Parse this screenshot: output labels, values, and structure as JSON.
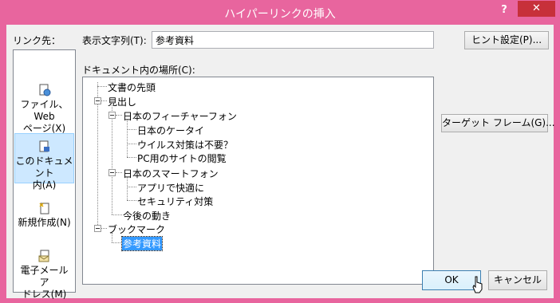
{
  "window": {
    "title": "ハイパーリンクの挿入",
    "help": "?",
    "close": "✕"
  },
  "linkto_label": "リンク先：",
  "sidebar": {
    "items": [
      {
        "label_l1": "ファイル、Web",
        "label_l2": "ページ(X)",
        "icon": "web-page-icon"
      },
      {
        "label_l1": "このドキュメント",
        "label_l2": "内(A)",
        "icon": "this-document-icon",
        "selected": true
      },
      {
        "label_l1": "新規作成(N)",
        "label_l2": "",
        "icon": "new-document-icon"
      },
      {
        "label_l1": "電子メール ア",
        "label_l2": "ドレス(M)",
        "icon": "email-icon"
      }
    ]
  },
  "display_text": {
    "label": "表示文字列(T):",
    "value": "参考資料"
  },
  "hint_button": "ヒント設定(P)...",
  "doc_location_label": "ドキュメント内の場所(C):",
  "tree": {
    "items": [
      "文書の先頭",
      "見出し",
      "日本のフィーチャーフォン",
      "日本のケータイ",
      "ウイルス対策は不要？",
      "PC用のサイトの閲覧",
      "日本のスマートフォン",
      "アプリで快適に",
      "セキュリティ対策",
      "今後の動き",
      "ブックマーク",
      "参考資料"
    ]
  },
  "target_frame_button": "ターゲット フレーム(G)...",
  "ok_button": "OK",
  "cancel_button": "キャンセル"
}
